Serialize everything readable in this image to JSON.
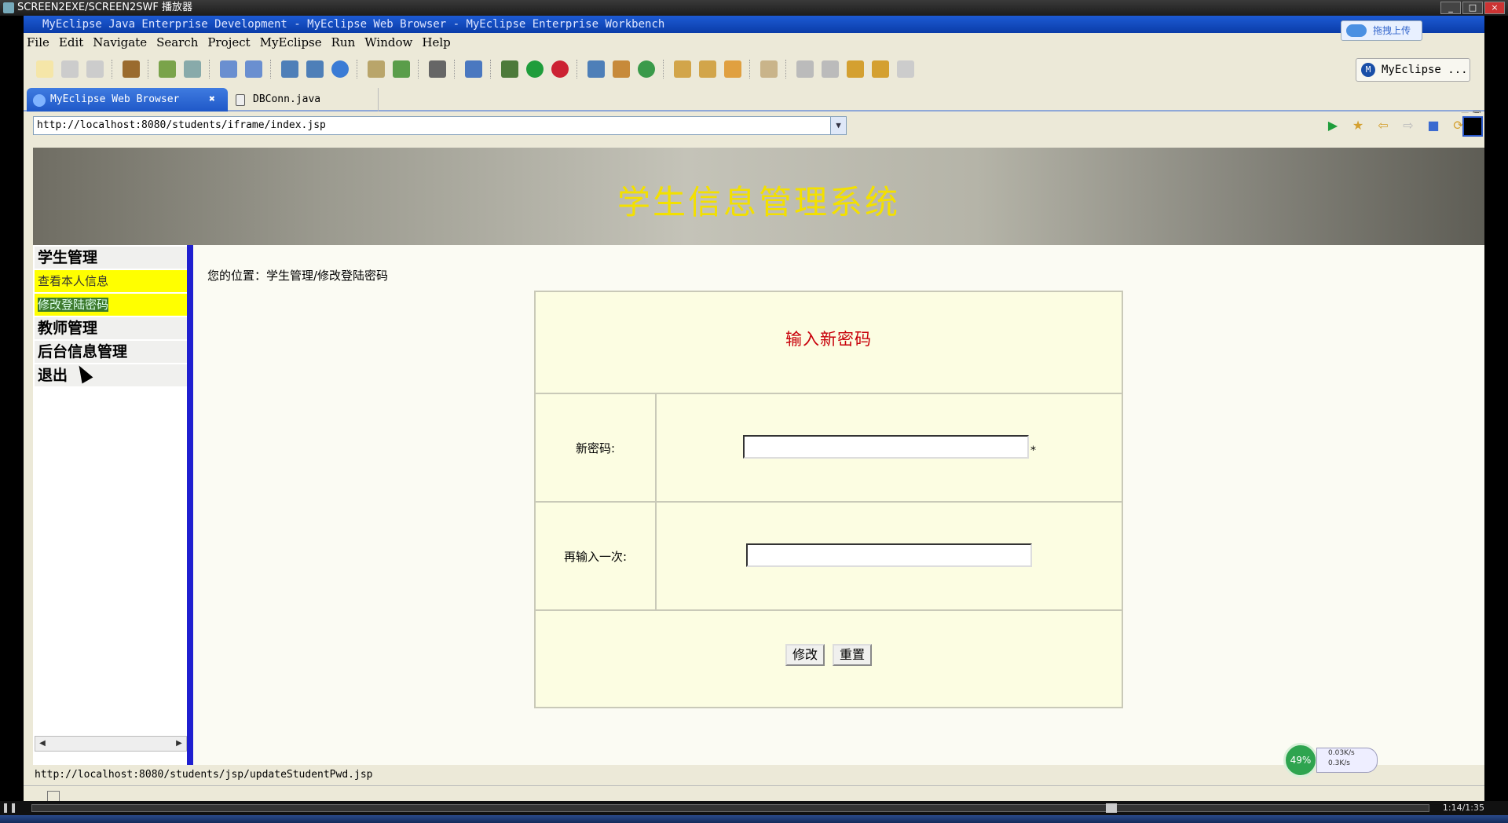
{
  "player": {
    "title": "SCREEN2EXE/SCREEN2SWF 播放器",
    "time": "1:14/1:35"
  },
  "eclipse": {
    "title": "MyEclipse Java Enterprise Development - MyEclipse Web Browser - MyEclipse Enterprise Workbench",
    "upload_label": "拖拽上传",
    "menu": [
      "File",
      "Edit",
      "Navigate",
      "Search",
      "Project",
      "MyEclipse",
      "Run",
      "Window",
      "Help"
    ],
    "perspective": "MyEclipse ...",
    "tabs": [
      {
        "label": "MyEclipse Web Browser",
        "close": "✖"
      },
      {
        "label": "DBConn.java"
      }
    ]
  },
  "browser": {
    "url": "http://localhost:8080/students/iframe/index.jsp",
    "status_url": "http://localhost:8080/students/jsp/updateStudentPwd.jsp"
  },
  "page": {
    "banner_title": "学生信息管理系统",
    "sidebar": {
      "sections": [
        {
          "label": "学生管理"
        },
        {
          "label": "教师管理"
        },
        {
          "label": "后台信息管理"
        },
        {
          "label": "退出"
        }
      ],
      "sub_items": [
        {
          "label": "查看本人信息"
        },
        {
          "label": "修改登陆密码"
        }
      ]
    },
    "breadcrumb": "您的位置：学生管理/修改登陆密码",
    "form": {
      "title": "输入新密码",
      "new_pwd_label": "新密码:",
      "confirm_label": "再输入一次:",
      "required_mark": "*",
      "submit_label": "修改",
      "reset_label": "重置"
    }
  },
  "net_monitor": {
    "cpu": "49%",
    "up": "0.03K/s",
    "down": "0.3K/s"
  }
}
